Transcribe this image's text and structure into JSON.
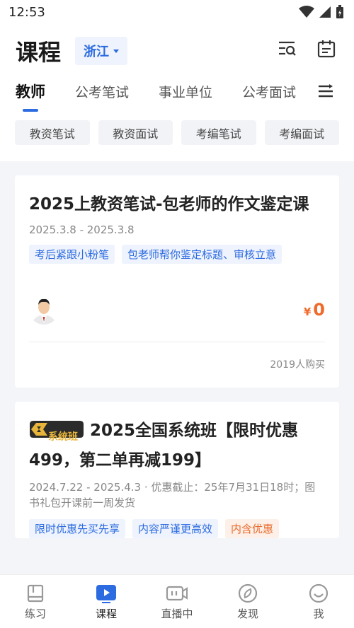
{
  "status": {
    "time": "12:53"
  },
  "header": {
    "title": "课程",
    "province": "浙江"
  },
  "tabs": [
    {
      "label": "教师"
    },
    {
      "label": "公考笔试"
    },
    {
      "label": "事业单位"
    },
    {
      "label": "公考面试"
    }
  ],
  "chips": [
    "教资笔试",
    "教资面试",
    "考编笔试",
    "考编面试"
  ],
  "cards": [
    {
      "title": "2025上教资笔试-包老师的作文鉴定课",
      "date": "2025.3.8 - 2025.3.8",
      "tags": [
        "考后紧跟小粉笔",
        "包老师帮你鉴定标题、审核立意"
      ],
      "price_symbol": "¥",
      "price": "0",
      "buyers": "2019人购买"
    },
    {
      "badge": "系统班",
      "title": "2025全国系统班【限时优惠499，第二单再减199】",
      "date": "2024.7.22 - 2025.4.3 · 优惠截止：25年7月31日18时；图书礼包开课前一周发货",
      "tags": [
        "限时优惠先买先享",
        "内容严谨更高效",
        "内含优惠"
      ]
    }
  ],
  "tabbar": [
    {
      "label": "练习",
      "icon": "book-icon"
    },
    {
      "label": "课程",
      "icon": "play-icon"
    },
    {
      "label": "直播中",
      "icon": "live-camera-icon"
    },
    {
      "label": "发现",
      "icon": "compass-icon"
    },
    {
      "label": "我",
      "icon": "smile-icon"
    }
  ],
  "colors": {
    "accent": "#2c6be0",
    "price": "#f06a2b",
    "tag_bg": "#eef3fd",
    "badge_gold": "#e8b53a"
  }
}
